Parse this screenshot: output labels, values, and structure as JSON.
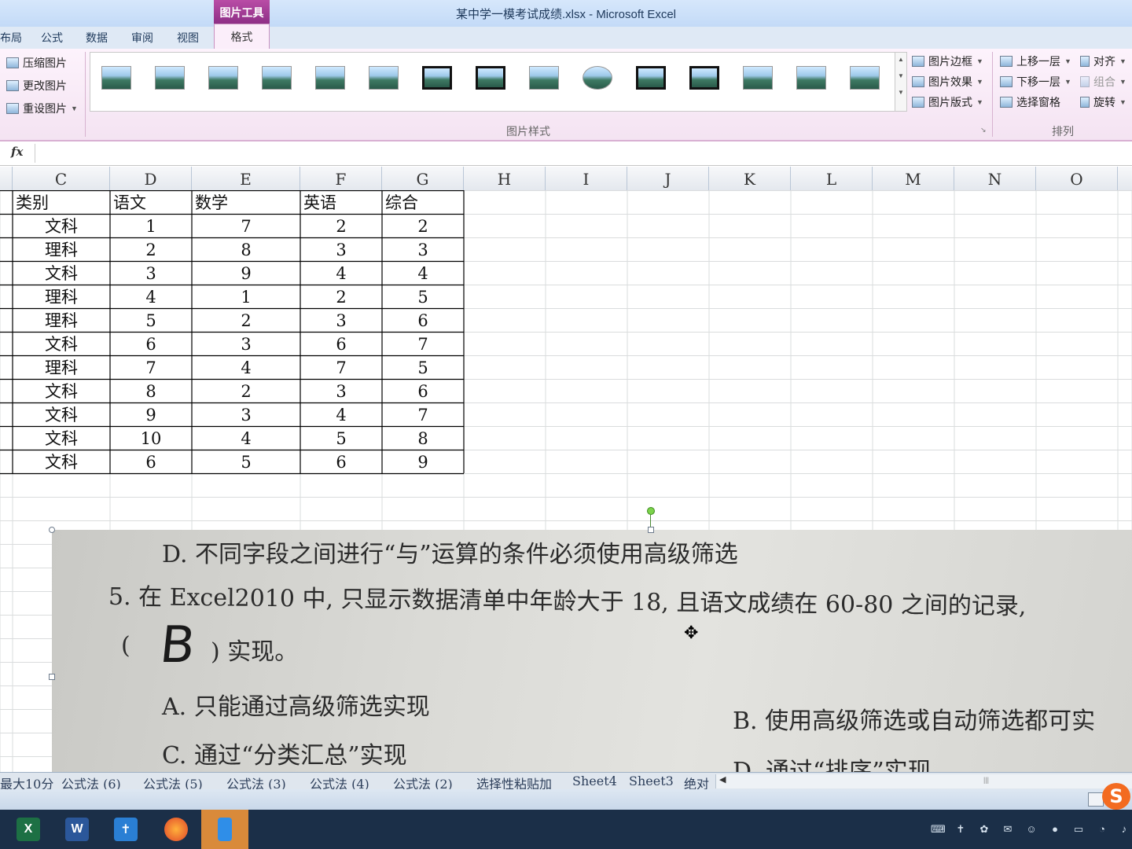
{
  "window": {
    "title": "某中学一模考试成绩.xlsx - Microsoft Excel",
    "context_group": "图片工具"
  },
  "tabs": [
    {
      "label": "布局"
    },
    {
      "label": "公式"
    },
    {
      "label": "数据"
    },
    {
      "label": "审阅"
    },
    {
      "label": "视图"
    }
  ],
  "active_tab": {
    "label": "格式"
  },
  "ribbon": {
    "adjust": {
      "compress": "压缩图片",
      "change": "更改图片",
      "reset": "重设图片"
    },
    "styles_group_label": "图片样式",
    "picture_border": "图片边框",
    "picture_effects": "图片效果",
    "picture_layout": "图片版式",
    "arrange": {
      "bring_forward": "上移一层",
      "send_backward": "下移一层",
      "selection_pane": "选择窗格",
      "align": "对齐",
      "group": "组合",
      "rotate": "旋转"
    },
    "arrange_group_label": "排列"
  },
  "formula_bar": {
    "fx": "fx",
    "content": ""
  },
  "columns": [
    "C",
    "D",
    "E",
    "F",
    "G",
    "H",
    "I",
    "J",
    "K",
    "L",
    "M",
    "N",
    "O"
  ],
  "table": {
    "headers": [
      "类别",
      "语文",
      "数学",
      "英语",
      "综合"
    ],
    "rows": [
      [
        "文科",
        "1",
        "7",
        "2",
        "2"
      ],
      [
        "理科",
        "2",
        "8",
        "3",
        "3"
      ],
      [
        "文科",
        "3",
        "9",
        "4",
        "4"
      ],
      [
        "理科",
        "4",
        "1",
        "2",
        "5"
      ],
      [
        "理科",
        "5",
        "2",
        "3",
        "6"
      ],
      [
        "文科",
        "6",
        "3",
        "6",
        "7"
      ],
      [
        "理科",
        "7",
        "4",
        "7",
        "5"
      ],
      [
        "文科",
        "8",
        "2",
        "3",
        "6"
      ],
      [
        "文科",
        "9",
        "3",
        "4",
        "7"
      ],
      [
        "文科",
        "10",
        "4",
        "5",
        "8"
      ],
      [
        "文科",
        "6",
        "5",
        "6",
        "9"
      ]
    ]
  },
  "picture": {
    "line1": "D. 不同字段之间进行“与”运算的条件必须使用高级筛选",
    "line2": "5. 在 Excel2010 中, 只显示数据清单中年龄大于 18, 且语文成绩在 60-80 之间的记录,",
    "line3_open": "(",
    "handwritten": "B",
    "line3_close": ") 实现。",
    "optA": "A. 只能通过高级筛选实现",
    "optB": "B. 使用高级筛选或自动筛选都可实",
    "optC": "C. 通过“分类汇总”实现",
    "optD": "D. 通过“排序”实现"
  },
  "sheet_tabs": [
    "最大10分",
    "公式法 (6)",
    "公式法 (5)",
    "公式法 (3)",
    "公式法 (4)",
    "公式法 (2)",
    "选择性粘贴加",
    "Sheet4",
    "Sheet3",
    "绝对"
  ],
  "taskbar": {
    "apps": [
      "excel-icon",
      "word-icon",
      "app-icon",
      "firefox-icon",
      "phone-icon"
    ]
  },
  "colors": {
    "excel_green": "#1d7044",
    "word_blue": "#2b579a",
    "picture_tools": "#a23c96"
  }
}
